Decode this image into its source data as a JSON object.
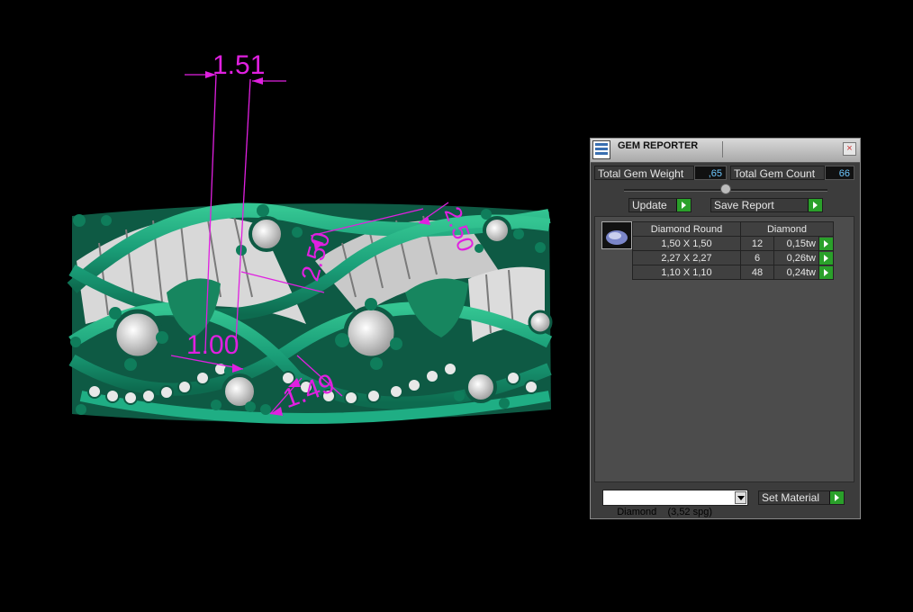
{
  "panel": {
    "title": "GEM REPORTER",
    "close_glyph": "×",
    "total_gem_weight_label": "Total Gem Weight",
    "total_gem_weight_value": ",65",
    "total_gem_count_label": "Total Gem Count",
    "total_gem_count_value": "66",
    "update_label": "Update",
    "save_report_label": "Save Report",
    "gem_icon": "gem-thumbnail-icon",
    "table": {
      "headers": [
        "Diamond Round",
        "Diamond"
      ],
      "rows": [
        {
          "size": "1,50 X 1,50",
          "count": "12",
          "weight": "0,15tw"
        },
        {
          "size": "2,27 X 2,27",
          "count": "6",
          "weight": "0,26tw"
        },
        {
          "size": "1,10 X 1,10",
          "count": "48",
          "weight": "0,24tw"
        }
      ]
    },
    "material_select": "Diamond    (3,52 spg)",
    "set_material_label": "Set Material"
  },
  "dimensions": [
    "1.51",
    "2.50",
    "2.50",
    "1.00",
    "1.49"
  ],
  "colors": {
    "ring": "#1a9e78",
    "dimension": "#e020e0",
    "button_arrow": "#2aa02a",
    "value_text": "#6ec8ff"
  }
}
